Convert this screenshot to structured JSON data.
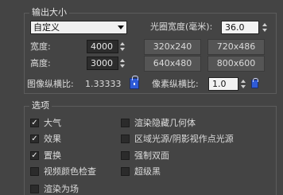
{
  "output_size": {
    "group_title": "输出大小",
    "preset_select": "自定义",
    "aperture_label": "光圈宽度(毫米):",
    "aperture_value": "36.0",
    "width_label": "宽度:",
    "width_value": "4000",
    "height_label": "高度:",
    "height_value": "3000",
    "presets": [
      "320x240",
      "720x486",
      "640x480",
      "800x600"
    ],
    "image_aspect_label": "图像纵横比:",
    "image_aspect_value": "1.33333",
    "pixel_aspect_label": "像素纵横比:",
    "pixel_aspect_value": "1.0"
  },
  "options": {
    "group_title": "选项",
    "left": [
      {
        "label": "大气",
        "checked": true
      },
      {
        "label": "效果",
        "checked": true
      },
      {
        "label": "置换",
        "checked": true
      },
      {
        "label": "视频颜色检查",
        "checked": false
      },
      {
        "label": "渲染为场",
        "checked": false
      }
    ],
    "right": [
      {
        "label": "渲染隐藏几何体",
        "checked": false
      },
      {
        "label": "区域光源/阴影视作点光源",
        "checked": false
      },
      {
        "label": "强制双面",
        "checked": false
      },
      {
        "label": "超级黑",
        "checked": false
      }
    ]
  }
}
